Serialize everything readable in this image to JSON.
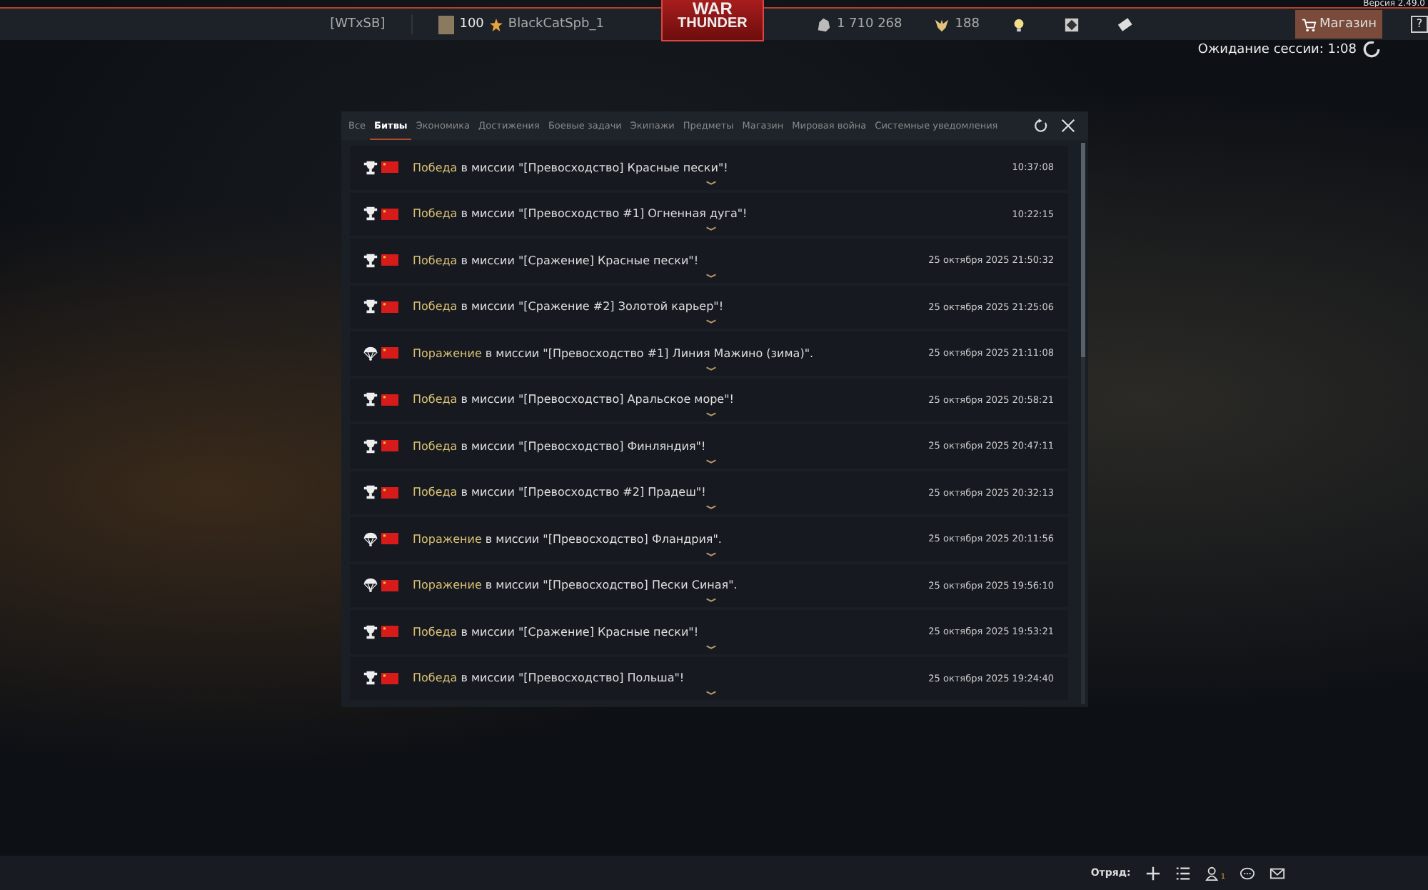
{
  "version": "Версия 2.49.0",
  "topbar": {
    "clan": "[WTxSB]",
    "level": "100",
    "nickname": "BlackCatSpb_1",
    "logo_top": "WAR",
    "logo_bottom": "THUNDER",
    "silver": "1 710 268",
    "gold": "188",
    "shop": "Магазин",
    "help": "?"
  },
  "session": "Ожидание сессии: 1:08",
  "tabs": [
    {
      "label": "Все",
      "selected": false
    },
    {
      "label": "Битвы",
      "selected": true
    },
    {
      "label": "Экономика",
      "selected": false
    },
    {
      "label": "Достижения",
      "selected": false
    },
    {
      "label": "Боевые задачи",
      "selected": false
    },
    {
      "label": "Экипажи",
      "selected": false
    },
    {
      "label": "Предметы",
      "selected": false
    },
    {
      "label": "Магазин",
      "selected": false
    },
    {
      "label": "Мировая война",
      "selected": false
    },
    {
      "label": "Системные уведомления",
      "selected": false
    }
  ],
  "notifications": [
    {
      "kind": "victory",
      "result": "Победа",
      "text": "в миссии \"[Превосходство] Красные пески\"!",
      "time": "10:37:08"
    },
    {
      "kind": "victory",
      "result": "Победа",
      "text": "в миссии \"[Превосходство #1] Огненная дуга\"!",
      "time": "10:22:15"
    },
    {
      "kind": "victory",
      "result": "Победа",
      "text": "в миссии \"[Сражение] Красные пески\"!",
      "time": "25 октября 2025 21:50:32"
    },
    {
      "kind": "victory",
      "result": "Победа",
      "text": "в миссии \"[Сражение #2] Золотой карьер\"!",
      "time": "25 октября 2025 21:25:06"
    },
    {
      "kind": "defeat",
      "result": "Поражение",
      "text": "в миссии \"[Превосходство #1] Линия Мажино (зима)\".",
      "time": "25 октября 2025 21:11:08"
    },
    {
      "kind": "victory",
      "result": "Победа",
      "text": "в миссии \"[Превосходство] Аральское море\"!",
      "time": "25 октября 2025 20:58:21"
    },
    {
      "kind": "victory",
      "result": "Победа",
      "text": "в миссии \"[Превосходство] Финляндия\"!",
      "time": "25 октября 2025 20:47:11"
    },
    {
      "kind": "victory",
      "result": "Победа",
      "text": "в миссии \"[Превосходство #2] Прадеш\"!",
      "time": "25 октября 2025 20:32:13"
    },
    {
      "kind": "defeat",
      "result": "Поражение",
      "text": "в миссии \"[Превосходство] Фландрия\".",
      "time": "25 октября 2025 20:11:56"
    },
    {
      "kind": "defeat",
      "result": "Поражение",
      "text": "в миссии \"[Превосходство] Пески Синая\".",
      "time": "25 октября 2025 19:56:10"
    },
    {
      "kind": "victory",
      "result": "Победа",
      "text": "в миссии \"[Сражение] Красные пески\"!",
      "time": "25 октября 2025 19:53:21"
    },
    {
      "kind": "victory",
      "result": "Победа",
      "text": "в миссии \"[Превосходство] Польша\"!",
      "time": "25 октября 2025 19:24:40"
    }
  ],
  "bottombar": {
    "squad": "Отряд:",
    "contacts_badge": "1"
  }
}
